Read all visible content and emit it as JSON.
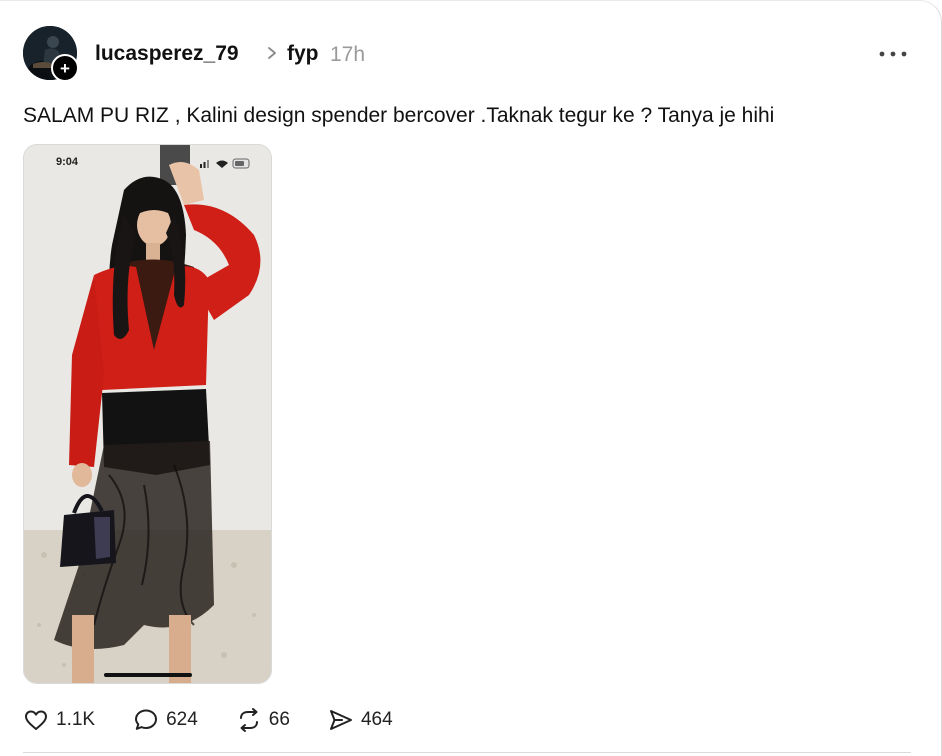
{
  "post": {
    "username": "lucasperez_79",
    "topic": "fyp",
    "time": "17h",
    "text": "SALAM PU RIZ , Kalini design spender bercover .Taknak tegur ke ? Tanya je hihi"
  },
  "media": {
    "status_time": "9:04"
  },
  "actions": {
    "likes": "1.1K",
    "comments": "624",
    "reposts": "66",
    "shares": "464"
  },
  "icons": {
    "follow": "plus-icon",
    "chevron": "chevron-right-icon",
    "more": "more-horizontal-icon",
    "like": "heart-icon",
    "comment": "speech-bubble-icon",
    "repost": "repost-icon",
    "share": "send-icon"
  },
  "colors": {
    "text": "#101010",
    "muted": "#9a9a9a",
    "sweater": "#d01f17",
    "background": "#ffffff"
  }
}
